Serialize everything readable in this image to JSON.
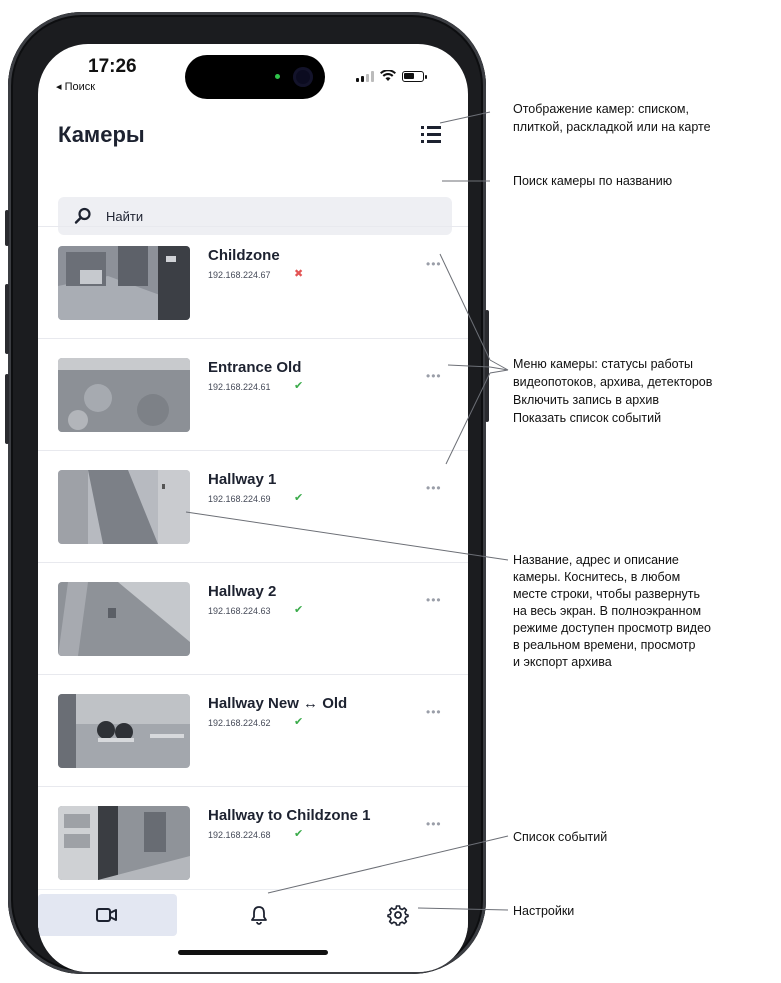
{
  "status_bar": {
    "time": "17:26",
    "back_label": "◂ Поиск"
  },
  "header": {
    "title": "Камеры"
  },
  "search": {
    "placeholder": "Найти"
  },
  "cameras": [
    {
      "name": "Childzone",
      "ip": "192.168.224.67",
      "status": "✖",
      "status_color": "#e35454"
    },
    {
      "name": "Entrance Old",
      "ip": "192.168.224.61",
      "status": "✔",
      "status_color": "#3aab4a"
    },
    {
      "name": "Hallway 1",
      "ip": "192.168.224.69",
      "status": "✔",
      "status_color": "#3aab4a"
    },
    {
      "name": "Hallway 2",
      "ip": "192.168.224.63",
      "status": "✔",
      "status_color": "#3aab4a"
    },
    {
      "name": "Hallway New ↔ Old",
      "ip": "192.168.224.62",
      "status": "✔",
      "status_color": "#3aab4a"
    },
    {
      "name": "Hallway to Childzone 1",
      "ip": "192.168.224.68",
      "status": "✔",
      "status_color": "#3aab4a"
    }
  ],
  "more_label": "•••",
  "tabs": [
    {
      "name": "cameras",
      "icon": "video-camera-icon",
      "active": true
    },
    {
      "name": "events",
      "icon": "bell-icon",
      "active": false
    },
    {
      "name": "settings",
      "icon": "gear-icon",
      "active": false
    }
  ],
  "annotations": {
    "view_mode": [
      "Отображение камер: списком,",
      "плиткой,  раскладкой или на карте"
    ],
    "search": [
      "Поиск камеры по названию"
    ],
    "menu": [
      "Меню камеры: статусы работы",
      "видеопотоков, архива, детекторов",
      "Включить запись в архив",
      "Показать список событий"
    ],
    "row": [
      "Название, адрес и описание",
      "камеры. Коснитесь, в любом",
      "месте строки, чтобы развернуть",
      "на весь экран. В полноэкранном",
      "режиме доступен просмотр видео",
      "в реальном времени, просмотр",
      "и экспорт архива"
    ],
    "events": [
      "Список событий"
    ],
    "settings": [
      "Настройки"
    ]
  }
}
